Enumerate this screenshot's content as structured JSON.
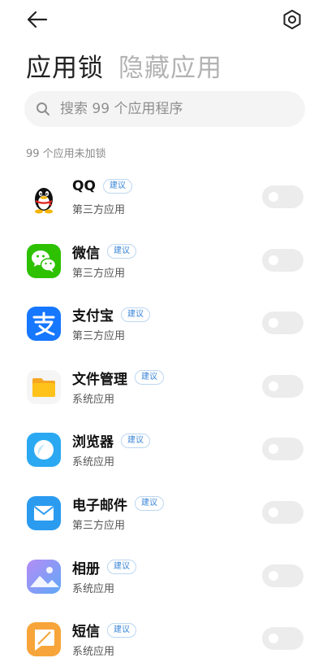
{
  "header": {
    "back_icon": "arrow-left-icon",
    "settings_icon": "settings-hexagon-icon"
  },
  "tabs": [
    {
      "label": "应用锁",
      "active": true
    },
    {
      "label": "隐藏应用",
      "active": false
    }
  ],
  "search": {
    "placeholder": "搜索 99 个应用程序",
    "icon": "search-icon"
  },
  "section_label": "99 个应用未加锁",
  "badge_label": "建议",
  "apps": [
    {
      "name": "QQ",
      "type": "第三方应用",
      "icon": "qq-penguin-icon",
      "badge": "建议",
      "locked": false
    },
    {
      "name": "微信",
      "type": "第三方应用",
      "icon": "wechat-icon",
      "badge": "建议",
      "locked": false
    },
    {
      "name": "支付宝",
      "type": "第三方应用",
      "icon": "alipay-icon",
      "badge": "建议",
      "locked": false
    },
    {
      "name": "文件管理",
      "type": "系统应用",
      "icon": "folder-icon",
      "badge": "建议",
      "locked": false
    },
    {
      "name": "浏览器",
      "type": "系统应用",
      "icon": "browser-icon",
      "badge": "建议",
      "locked": false
    },
    {
      "name": "电子邮件",
      "type": "第三方应用",
      "icon": "mail-icon",
      "badge": "建议",
      "locked": false
    },
    {
      "name": "相册",
      "type": "系统应用",
      "icon": "gallery-icon",
      "badge": "建议",
      "locked": false
    },
    {
      "name": "短信",
      "type": "系统应用",
      "icon": "messages-icon",
      "badge": "建议",
      "locked": false
    }
  ],
  "colors": {
    "wechat_green": "#2dc100",
    "alipay_blue": "#1677ff",
    "badge_blue": "#3b86d6",
    "toggle_off": "#ececec"
  }
}
